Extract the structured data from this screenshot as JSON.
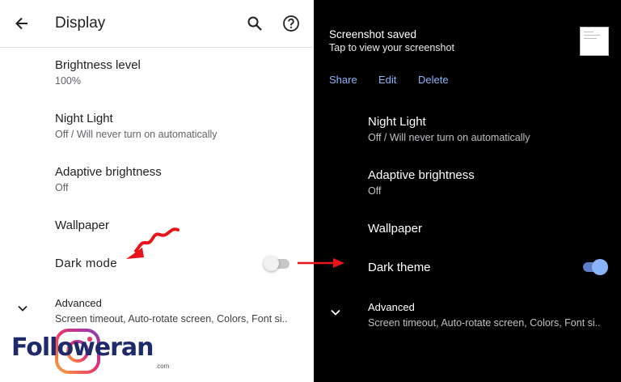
{
  "left": {
    "app_bar": {
      "title": "Display",
      "back_icon": "arrow-back-icon",
      "search_icon": "search-icon",
      "help_icon": "help-icon"
    },
    "items": [
      {
        "title": "Brightness level",
        "summary": "100%"
      },
      {
        "title": "Night Light",
        "summary": "Off / Will never turn on automatically"
      },
      {
        "title": "Adaptive brightness",
        "summary": "Off"
      },
      {
        "title": "Wallpaper",
        "summary": ""
      },
      {
        "title": "Dark mode",
        "summary": ""
      },
      {
        "title": "Advanced",
        "summary": "Screen timeout, Auto-rotate screen, Colors, Font si.."
      }
    ],
    "dark_mode_toggle": {
      "state": "off"
    },
    "expand_icon": "chevron-down-icon"
  },
  "right": {
    "notification": {
      "title": "Screenshot saved",
      "subtitle": "Tap to view your screenshot",
      "actions": [
        "Share",
        "Edit",
        "Delete"
      ]
    },
    "items": [
      {
        "title": "Night Light",
        "summary": "Off / Will never turn on automatically"
      },
      {
        "title": "Adaptive brightness",
        "summary": "Off"
      },
      {
        "title": "Wallpaper",
        "summary": ""
      },
      {
        "title": "Dark theme",
        "summary": ""
      },
      {
        "title": "Advanced",
        "summary": "Screen timeout, Auto-rotate screen, Colors, Font si.."
      }
    ],
    "dark_theme_toggle": {
      "state": "on"
    },
    "expand_icon": "chevron-down-icon"
  },
  "watermark": {
    "brand": "Followeran",
    "domain": ".com"
  },
  "colors": {
    "light_bg": "#ffffff",
    "dark_bg": "#000000",
    "accent_blue": "#8ab4f8",
    "annotation_red": "#e8141b",
    "brand_navy": "#1f2a6b"
  }
}
